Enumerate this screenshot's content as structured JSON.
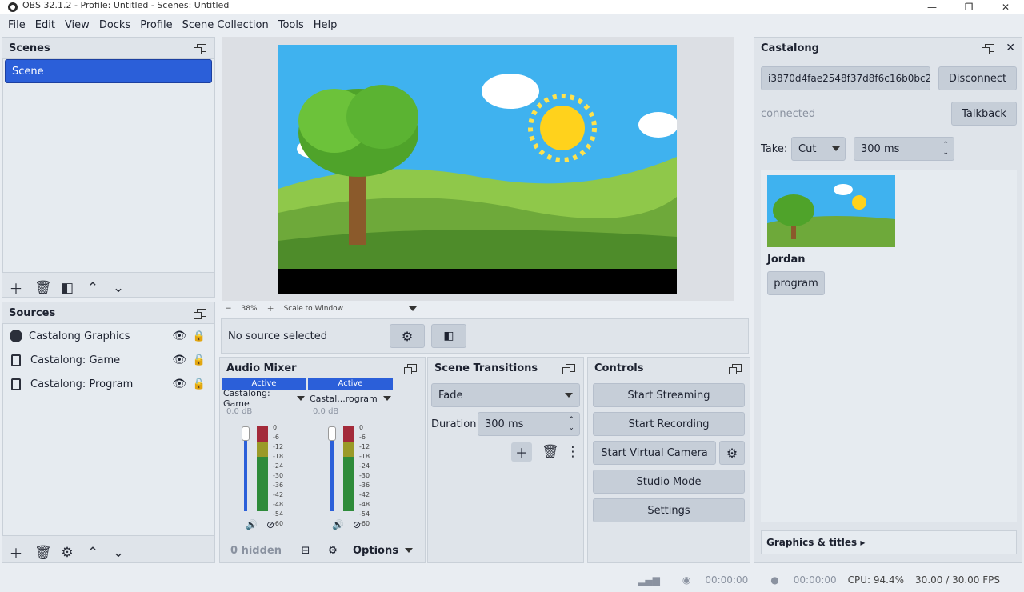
{
  "window": {
    "title": "OBS 32.1.2 - Profile: Untitled - Scenes: Untitled"
  },
  "menu": [
    "File",
    "Edit",
    "View",
    "Docks",
    "Profile",
    "Scene Collection",
    "Tools",
    "Help"
  ],
  "scenes": {
    "title": "Scenes",
    "items": [
      "Scene"
    ]
  },
  "sources": {
    "title": "Sources",
    "items": [
      "Castalong Graphics",
      "Castalong: Game",
      "Castalong: Program"
    ]
  },
  "preview": {
    "zoom": "38%",
    "scale_mode": "Scale to Window"
  },
  "source_bar": {
    "label": "No source selected"
  },
  "audio_mixer": {
    "title": "Audio Mixer",
    "channels": [
      {
        "status": "Active",
        "name": "Castalong: Game",
        "db": "0.0 dB"
      },
      {
        "status": "Active",
        "name": "Castal...rogram",
        "db": "0.0 dB"
      }
    ],
    "scale": [
      "0",
      "-6",
      "-12",
      "-18",
      "-24",
      "-30",
      "-36",
      "-42",
      "-48",
      "-54",
      "-60"
    ],
    "hidden": "0 hidden",
    "options": "Options"
  },
  "transitions": {
    "title": "Scene Transitions",
    "selected": "Fade",
    "duration_label": "Duration",
    "duration": "300 ms"
  },
  "controls": {
    "title": "Controls",
    "buttons": [
      "Start Streaming",
      "Start Recording",
      "Start Virtual Camera",
      "Studio Mode",
      "Settings"
    ]
  },
  "castalong": {
    "title": "Castalong",
    "key": "i3870d4fae2548f37d8f6c16b0bc2",
    "disconnect": "Disconnect",
    "status": "connected",
    "talkback": "Talkback",
    "take_label": "Take:",
    "take_mode": "Cut",
    "take_duration": "300 ms",
    "thumb_name": "Jordan",
    "program_btn": "program",
    "graphics": "Graphics & titles ▸"
  },
  "status": {
    "stream_time": "00:00:00",
    "rec_time": "00:00:00",
    "cpu": "CPU: 94.4%",
    "fps": "30.00 / 30.00 FPS"
  },
  "colors": {
    "accent": "#2b5fd9",
    "panel": "#dfe4ea",
    "button": "#c6ced8",
    "meter_green": "#2e8b3a",
    "meter_yellow": "#9a9a28",
    "meter_red": "#a32a3a"
  }
}
